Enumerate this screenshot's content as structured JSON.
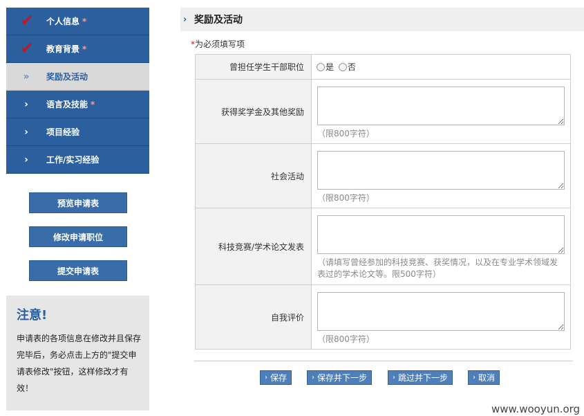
{
  "sidebar": {
    "items": [
      {
        "label": "个人信息",
        "star": "*"
      },
      {
        "label": "教育背景",
        "star": "*"
      },
      {
        "label": "奖励及活动",
        "star": ""
      },
      {
        "label": "语言及技能",
        "star": "*"
      },
      {
        "label": "项目经验",
        "star": ""
      },
      {
        "label": "工作/实习经验",
        "star": ""
      }
    ],
    "buttons": {
      "preview": "预览申请表",
      "modify_position": "修改申请职位",
      "submit": "提交申请表"
    }
  },
  "notice": {
    "title": "注意!",
    "text": "申请表的各项信息在修改并且保存完毕后，务必点击上方的\"提交申请表修改\"按钮，这样修改才有效！"
  },
  "main": {
    "section_title": "奖励及活动",
    "required_star": "*",
    "required_note": "为必须填写项",
    "rows": {
      "cadre_label": "曾担任学生干部职位",
      "cadre_yes": "是",
      "cadre_no": "否",
      "scholarship_label": "获得奖学金及其他奖励",
      "scholarship_hint": "（限800字符）",
      "social_label": "社会活动",
      "social_hint": "（限800字符）",
      "competition_label": "科技竞赛/学术论文发表",
      "competition_hint": "（请填写曾经参加的科技竞赛、获奖情况，以及在专业学术领域发表过的学术论文等。限500字符）",
      "self_label": "自我评价",
      "self_hint": "（限800字符）"
    },
    "buttons": {
      "save": "保存",
      "save_next": "保存并下一步",
      "skip_next": "跳过并下一步",
      "cancel": "取消"
    }
  },
  "watermark": "www.wooyun.org"
}
